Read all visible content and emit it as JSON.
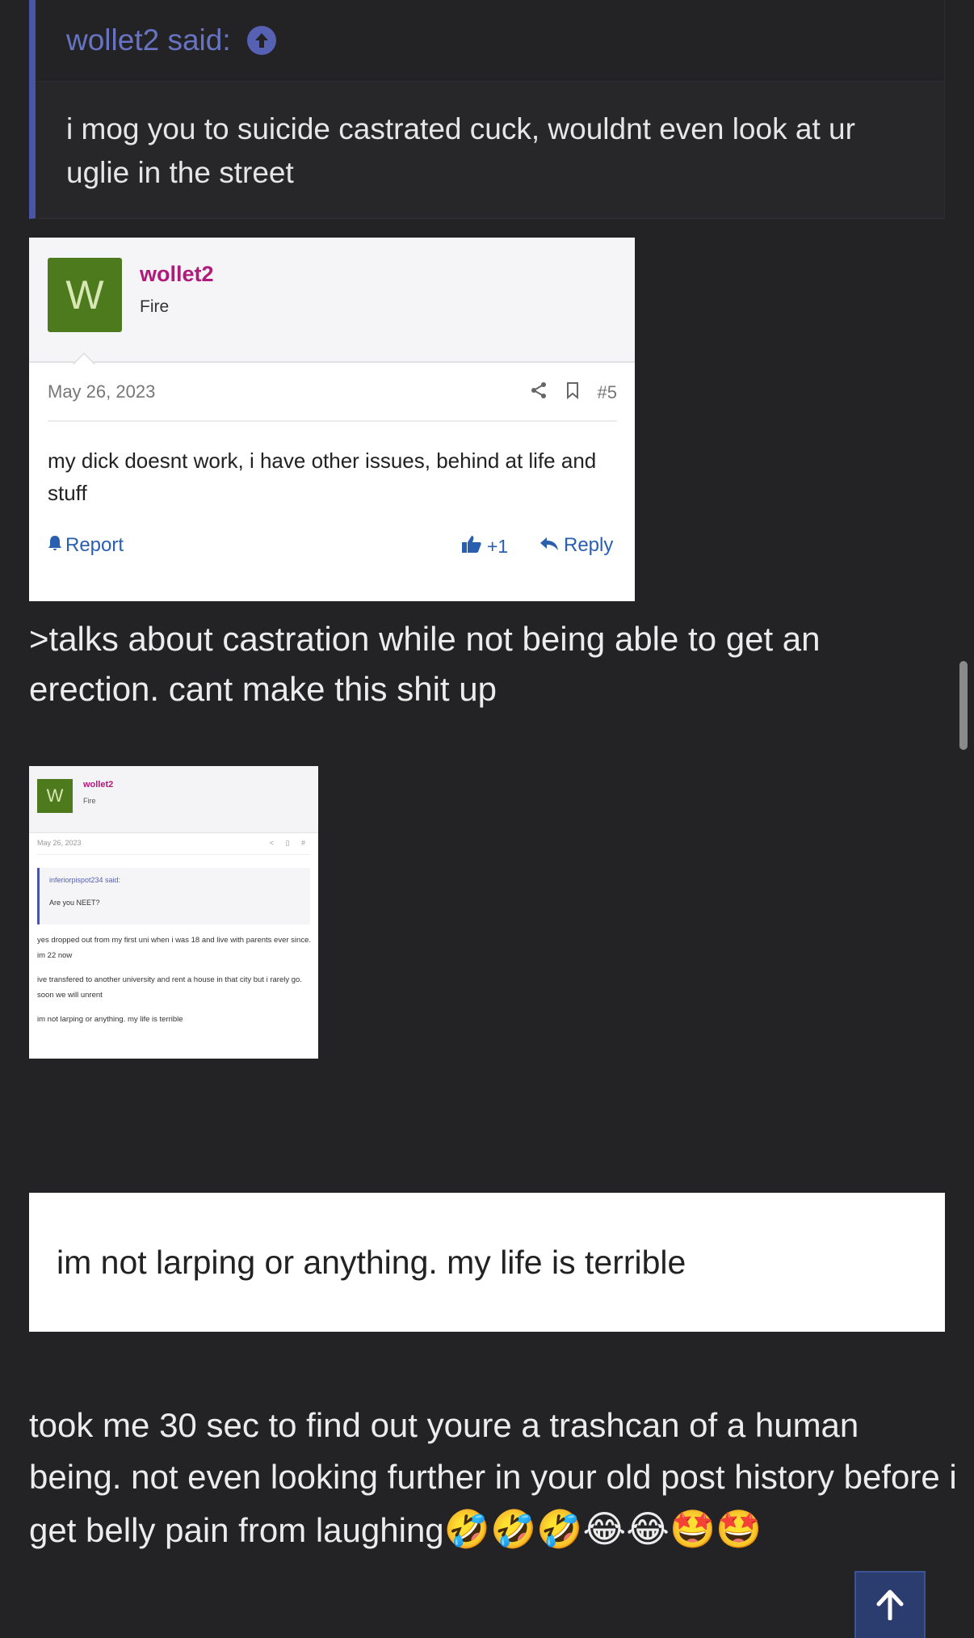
{
  "quote": {
    "author_label": "wollet2 said:",
    "icon": "arrow-up-circle-icon",
    "text": "i mog you to suicide castrated cuck, wouldnt even look at ur uglie in the street",
    "accent_color": "#4a55a8"
  },
  "screenshot1": {
    "avatar_letter": "W",
    "username": "wollet2",
    "user_title": "Fire",
    "date": "May 26, 2023",
    "post_number": "#5",
    "body": "my dick doesnt work, i have other issues, behind at life and stuff",
    "report_label": "Report",
    "like_count": "+1",
    "reply_label": "Reply"
  },
  "text1": ">talks about castration while not being able to get an erection. cant make this shit up",
  "screenshot2": {
    "avatar_letter": "W",
    "username": "wollet2",
    "user_title": "Fire",
    "date": "May 26, 2023",
    "quote_author": "inferiorpispot234 said:",
    "quote_text": "Are you NEET?",
    "paragraphs": [
      "yes dropped out from my first uni when i was 18 and live with parents ever since. im 22 now",
      "ive transfered to another university and rent a house in that city but i rarely go. soon we will unrent",
      "im not larping or anything. my life is terrible"
    ]
  },
  "screenshot3": {
    "text": "im not larping or anything. my life is terrible"
  },
  "text2": {
    "main": "took me 30 sec to find out youre a trashcan of a human being. not even looking further in your old post history before i get belly pain from laughing",
    "emojis": "🤣🤣🤣😂😂🤩🤩"
  },
  "scroll_to_top_icon": "arrow-up-icon"
}
